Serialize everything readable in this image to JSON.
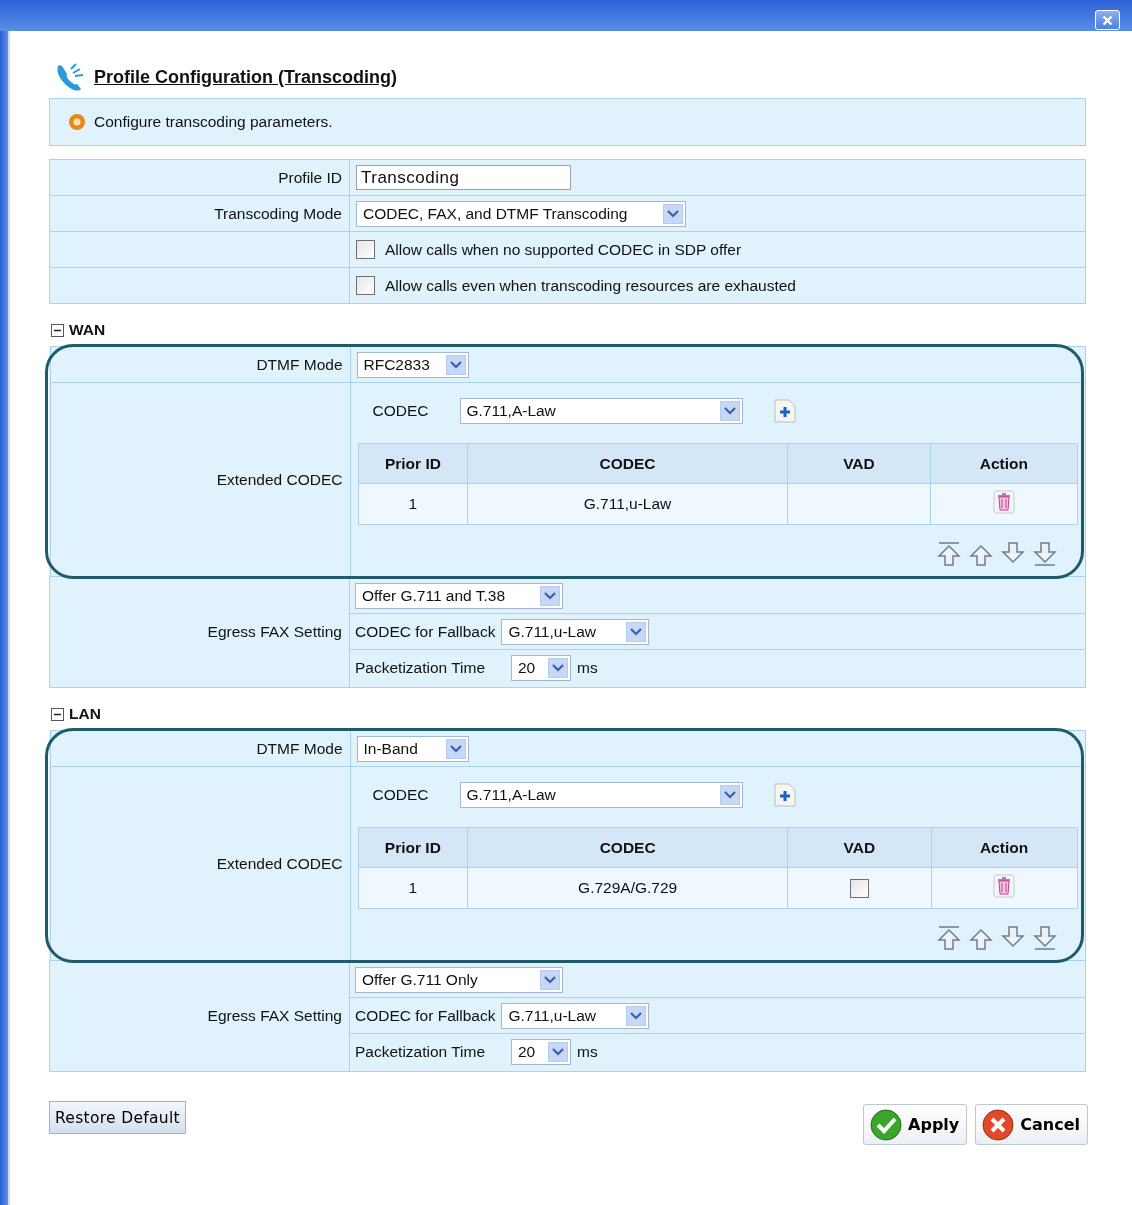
{
  "title": "Profile Configuration (Transcoding)",
  "info": "Configure transcoding parameters.",
  "profile": {
    "id_label": "Profile ID",
    "id_value": "Transcoding",
    "mode_label": "Transcoding Mode",
    "mode_value": "CODEC, FAX, and DTMF Transcoding",
    "options": [
      {
        "label": "Allow calls when no supported CODEC in SDP offer",
        "checked": false
      },
      {
        "label": "Allow calls even when transcoding resources are exhausted",
        "checked": false
      }
    ]
  },
  "sections": [
    {
      "title": "WAN",
      "expanded": true,
      "highlighted": true,
      "dtmf_label": "DTMF Mode",
      "dtmf_value": "RFC2833",
      "ext_label": "Extended CODEC",
      "codec_label": "CODEC",
      "codec_value": "G.711,A-Law",
      "columns": [
        "Prior ID",
        "CODEC",
        "VAD",
        "Action"
      ],
      "rows": [
        {
          "prior_id": "1",
          "codec": "G.711,u-Law",
          "kind": "plain"
        }
      ],
      "fax_label": "Egress FAX Setting",
      "fax_value": "Offer G.711 and T.38",
      "fallback_label": "CODEC for Fallback",
      "fallback_value": "G.711,u-Law",
      "ptime_label": "Packetization Time",
      "ptime_value": "20",
      "ptime_unit": "ms"
    },
    {
      "title": "LAN",
      "expanded": true,
      "highlighted": true,
      "dtmf_label": "DTMF Mode",
      "dtmf_value": "In-Band",
      "ext_label": "Extended CODEC",
      "codec_label": "CODEC",
      "codec_value": "G.711,A-Law",
      "columns": [
        "Prior ID",
        "CODEC",
        "VAD",
        "Action"
      ],
      "rows": [
        {
          "prior_id": "1",
          "codec": "G.729A/G.729",
          "kind": "checkbox",
          "vad_checked": false
        }
      ],
      "fax_label": "Egress FAX Setting",
      "fax_value": "Offer G.711 Only",
      "fallback_label": "CODEC for Fallback",
      "fallback_value": "G.711,u-Law",
      "ptime_label": "Packetization Time",
      "ptime_value": "20",
      "ptime_unit": "ms"
    }
  ],
  "buttons": {
    "restore": "Restore Default",
    "apply": "Apply",
    "cancel": "Cancel"
  }
}
